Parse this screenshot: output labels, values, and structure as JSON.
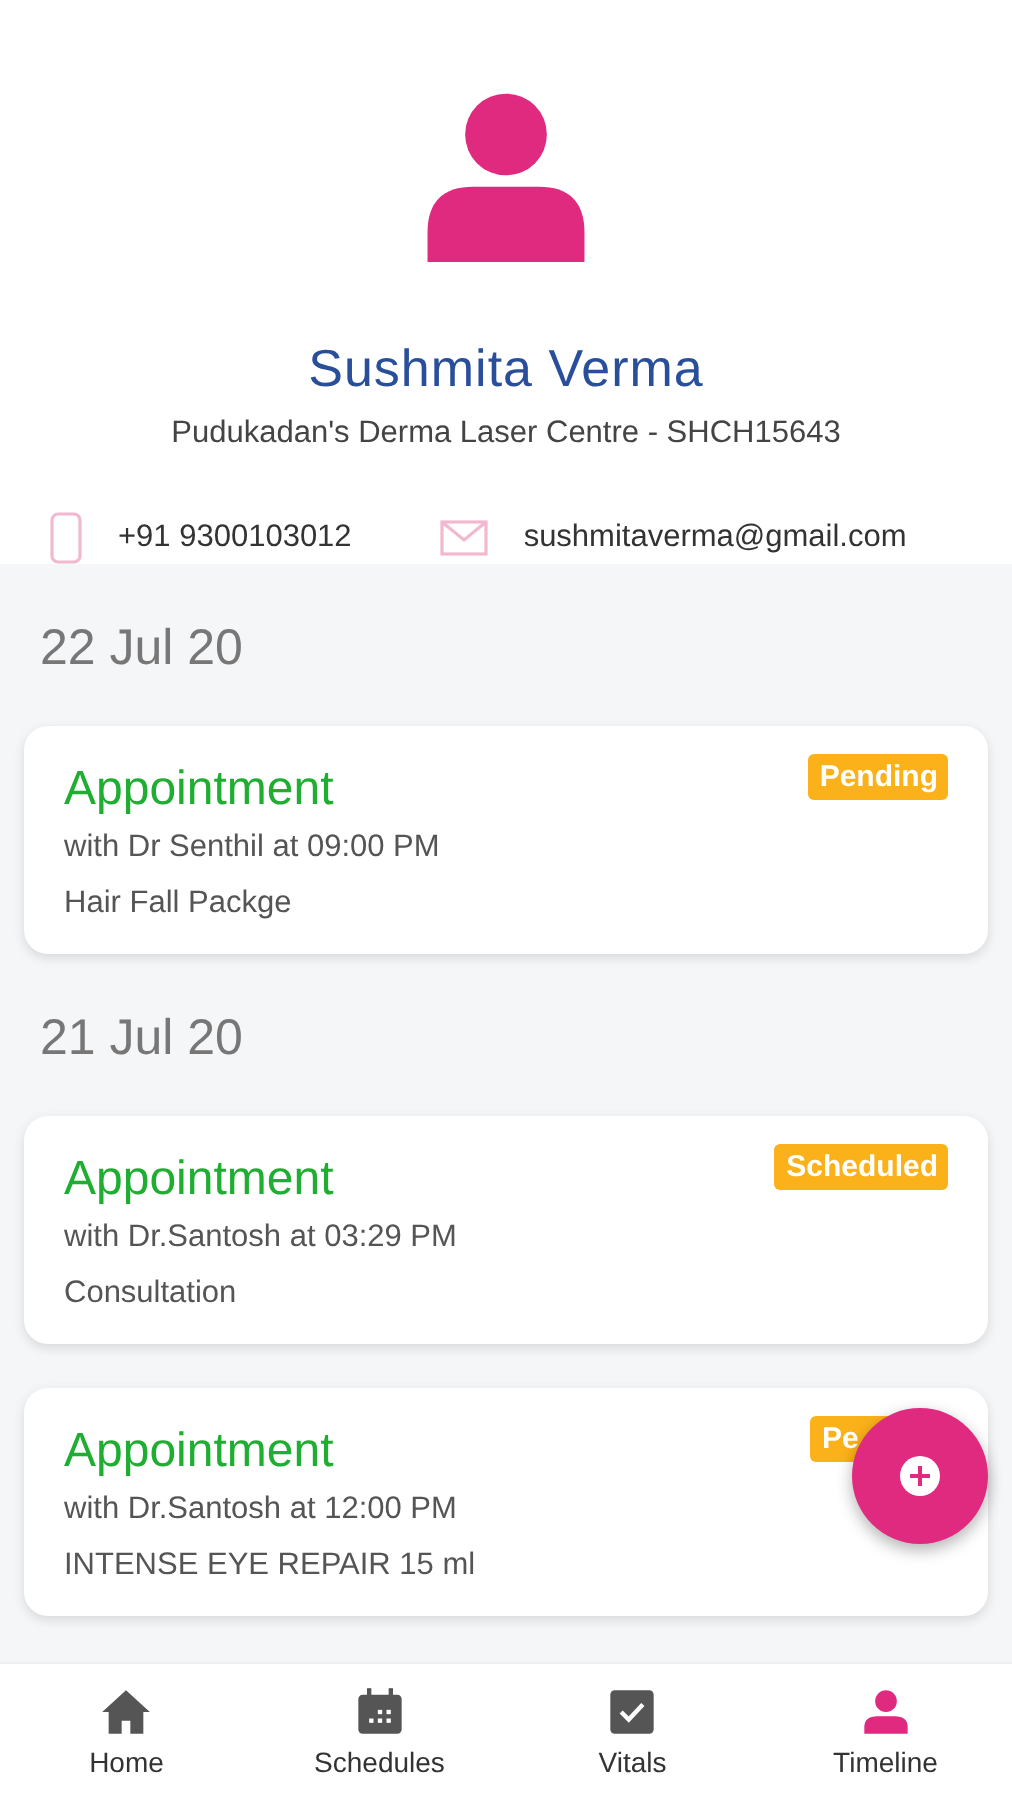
{
  "profile": {
    "name": "Sushmita Verma",
    "clinic": "Pudukadan's Derma Laser Centre - SHCH15643",
    "phone": "+91 9300103012",
    "email": "sushmitaverma@gmail.com"
  },
  "groups": [
    {
      "date": "22 Jul 20",
      "entries": [
        {
          "title": "Appointment",
          "detail": "with Dr Senthil at 09:00 PM",
          "note": "Hair Fall Packge",
          "status": "Pending"
        }
      ]
    },
    {
      "date": "21 Jul 20",
      "entries": [
        {
          "title": "Appointment",
          "detail": "with Dr.Santosh at 03:29 PM",
          "note": "Consultation",
          "status": "Scheduled"
        },
        {
          "title": "Appointment",
          "detail": "with Dr.Santosh at 12:00 PM",
          "note": "INTENSE EYE REPAIR 15 ml",
          "status": "Pe"
        }
      ]
    }
  ],
  "nav": [
    {
      "label": "Home",
      "kind": "home",
      "selected": false
    },
    {
      "label": "Schedules",
      "kind": "calendar",
      "selected": false
    },
    {
      "label": "Vitals",
      "kind": "check",
      "selected": false
    },
    {
      "label": "Timeline",
      "kind": "person",
      "selected": true
    }
  ]
}
